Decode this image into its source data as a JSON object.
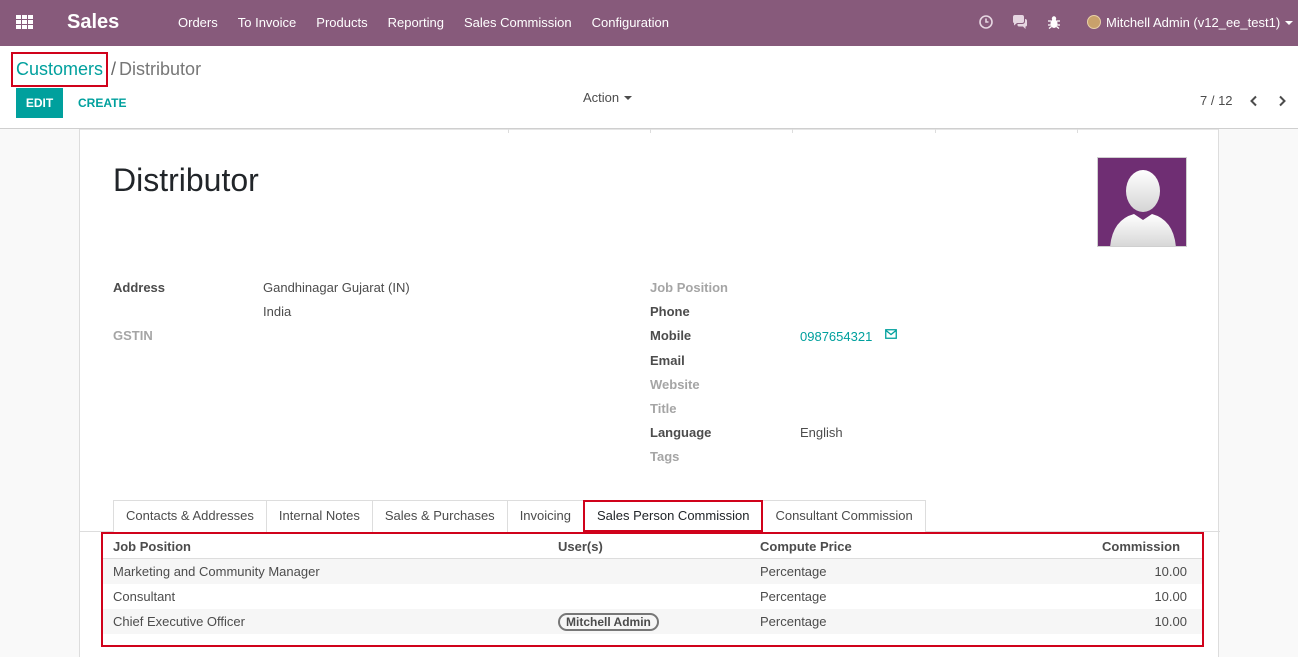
{
  "navbar": {
    "brand": "Sales",
    "menu": [
      "Orders",
      "To Invoice",
      "Products",
      "Reporting",
      "Sales Commission",
      "Configuration"
    ],
    "user": "Mitchell Admin (v12_ee_test1)",
    "icons": [
      "apps-icon",
      "clock-icon",
      "chat-icon",
      "bug-icon"
    ]
  },
  "breadcrumb": {
    "parent": "Customers",
    "separator": "/",
    "current": "Distributor"
  },
  "buttons": {
    "edit": "EDIT",
    "create": "CREATE",
    "action": "Action"
  },
  "pager": {
    "value": "7 / 12"
  },
  "record": {
    "name": "Distributor",
    "address_label": "Address",
    "address_line1": "Gandhinagar  Gujarat (IN)",
    "address_line2": "India",
    "gstin_label": "GSTIN",
    "job_position_label": "Job Position",
    "phone_label": "Phone",
    "mobile_label": "Mobile",
    "mobile_value": "0987654321",
    "email_label": "Email",
    "website_label": "Website",
    "title_label": "Title",
    "language_label": "Language",
    "language_value": "English",
    "tags_label": "Tags"
  },
  "tabs": [
    "Contacts & Addresses",
    "Internal Notes",
    "Sales & Purchases",
    "Invoicing",
    "Sales Person Commission",
    "Consultant Commission"
  ],
  "active_tab": "Sales Person Commission",
  "commission_table": {
    "headers": [
      "Job Position",
      "User(s)",
      "Compute Price",
      "Commission"
    ],
    "rows": [
      {
        "job_position": "Marketing and Community Manager",
        "users": "",
        "compute_price": "Percentage",
        "commission": "10.00"
      },
      {
        "job_position": "Consultant",
        "users": "",
        "compute_price": "Percentage",
        "commission": "10.00"
      },
      {
        "job_position": "Chief Executive Officer",
        "users": "Mitchell Admin",
        "compute_price": "Percentage",
        "commission": "10.00"
      }
    ]
  },
  "colors": {
    "navbar": "#875a7b",
    "accent": "#00a09d",
    "highlight": "#d0021b",
    "avatar_bg": "#6f2e73"
  }
}
